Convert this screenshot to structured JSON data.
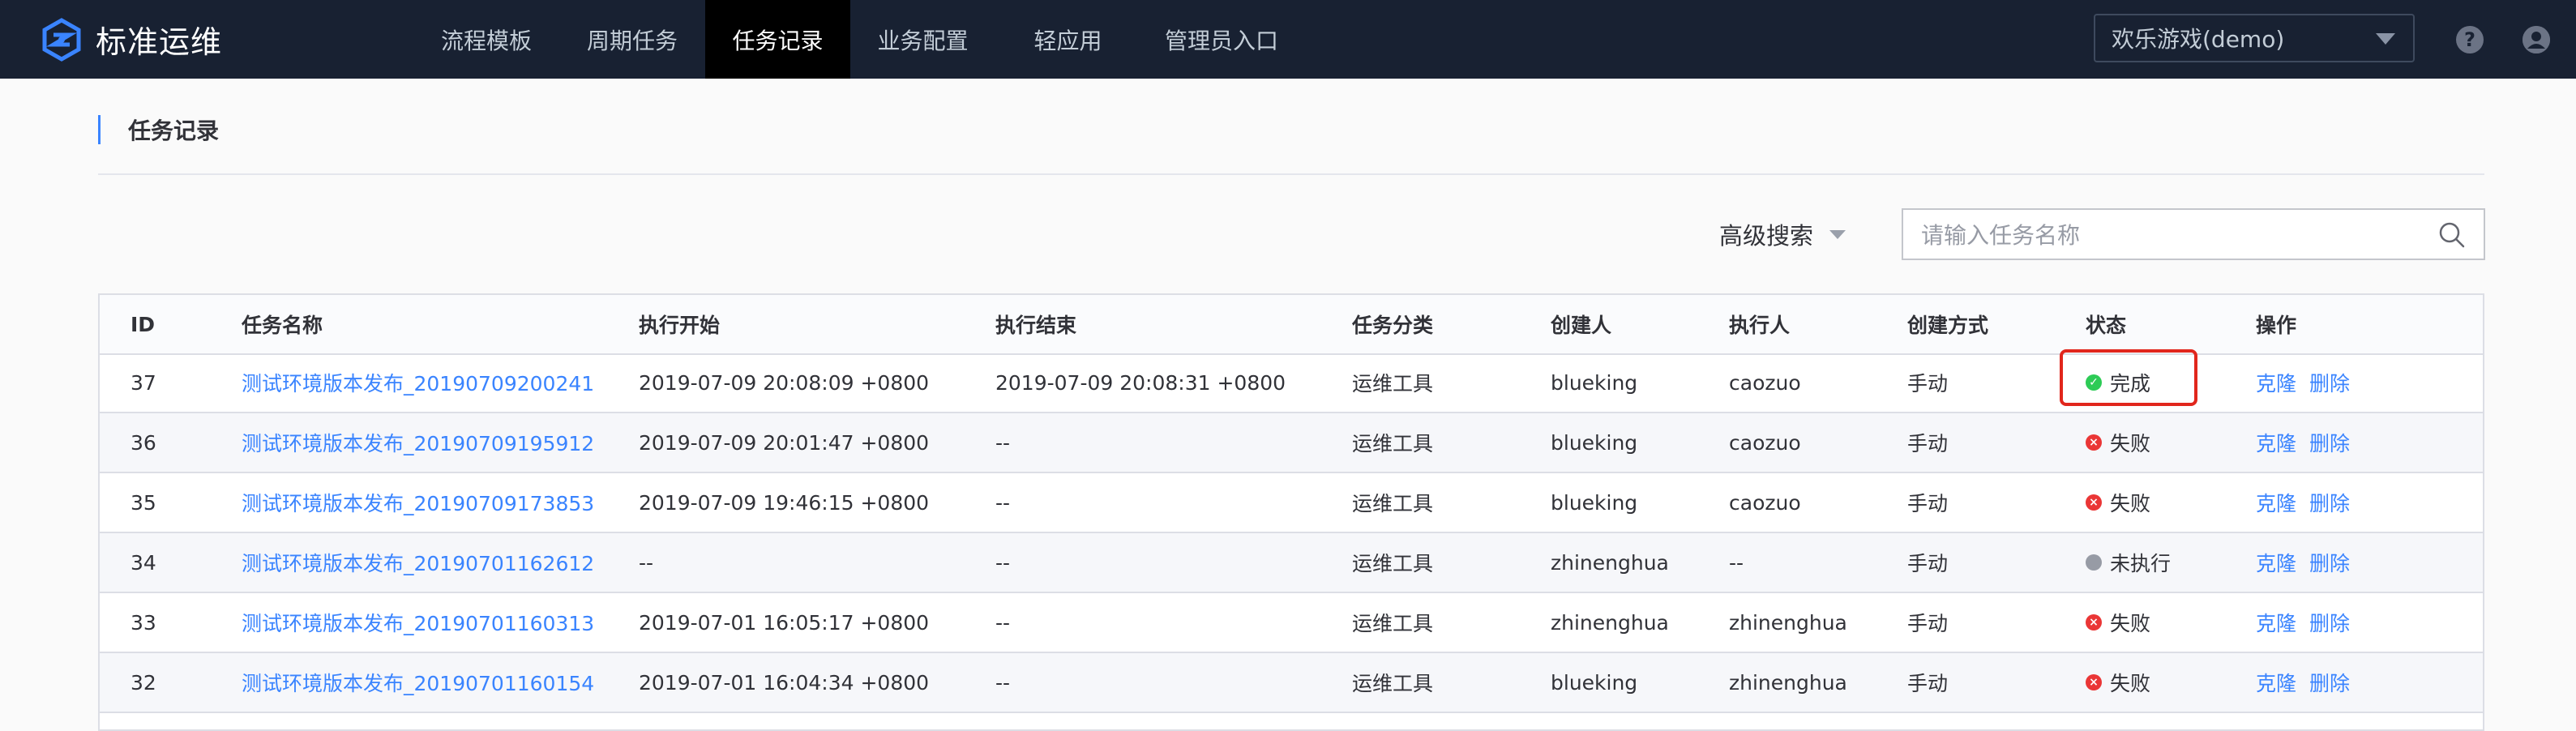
{
  "app": {
    "title": "标准运维"
  },
  "nav": {
    "items": [
      {
        "label": "流程模板"
      },
      {
        "label": "周期任务"
      },
      {
        "label": "任务记录"
      },
      {
        "label": "业务配置"
      },
      {
        "label": "轻应用"
      },
      {
        "label": "管理员入口"
      }
    ],
    "active_index": 2
  },
  "business_select": {
    "value": "欢乐游戏(demo)"
  },
  "header_icons": [
    "help-icon",
    "user-icon"
  ],
  "page": {
    "title": "任务记录"
  },
  "search": {
    "advanced_label": "高级搜索",
    "placeholder": "请输入任务名称"
  },
  "table": {
    "columns": [
      "ID",
      "任务名称",
      "执行开始",
      "执行结束",
      "任务分类",
      "创建人",
      "执行人",
      "创建方式",
      "状态",
      "操作"
    ],
    "rows": [
      {
        "id": "37",
        "name": "测试环境版本发布_20190709200241",
        "start": "2019-07-09 20:08:09 +0800",
        "end": "2019-07-09 20:08:31 +0800",
        "category": "运维工具",
        "creator": "blueking",
        "executor": "caozuo",
        "method": "手动",
        "status": "完成",
        "status_type": "success",
        "op_clone": "克隆",
        "op_delete": "删除"
      },
      {
        "id": "36",
        "name": "测试环境版本发布_20190709195912",
        "start": "2019-07-09 20:01:47 +0800",
        "end": "--",
        "category": "运维工具",
        "creator": "blueking",
        "executor": "caozuo",
        "method": "手动",
        "status": "失败",
        "status_type": "failed",
        "op_clone": "克隆",
        "op_delete": "删除"
      },
      {
        "id": "35",
        "name": "测试环境版本发布_20190709173853",
        "start": "2019-07-09 19:46:15 +0800",
        "end": "--",
        "category": "运维工具",
        "creator": "blueking",
        "executor": "caozuo",
        "method": "手动",
        "status": "失败",
        "status_type": "failed",
        "op_clone": "克隆",
        "op_delete": "删除"
      },
      {
        "id": "34",
        "name": "测试环境版本发布_20190701162612",
        "start": "--",
        "end": "--",
        "category": "运维工具",
        "creator": "zhinenghua",
        "executor": "--",
        "method": "手动",
        "status": "未执行",
        "status_type": "pending",
        "op_clone": "克隆",
        "op_delete": "删除"
      },
      {
        "id": "33",
        "name": "测试环境版本发布_20190701160313",
        "start": "2019-07-01 16:05:17 +0800",
        "end": "--",
        "category": "运维工具",
        "creator": "zhinenghua",
        "executor": "zhinenghua",
        "method": "手动",
        "status": "失败",
        "status_type": "failed",
        "op_clone": "克隆",
        "op_delete": "删除"
      },
      {
        "id": "32",
        "name": "测试环境版本发布_20190701160154",
        "start": "2019-07-01 16:04:34 +0800",
        "end": "--",
        "category": "运维工具",
        "creator": "blueking",
        "executor": "zhinenghua",
        "method": "手动",
        "status": "失败",
        "status_type": "failed",
        "op_clone": "克隆",
        "op_delete": "删除"
      }
    ]
  },
  "colors": {
    "topbar_bg": "#182132",
    "accent": "#3a84ff",
    "success": "#2dcb56",
    "failed": "#ea3636",
    "pending": "#979ba5",
    "highlight_border": "#e1261c"
  }
}
